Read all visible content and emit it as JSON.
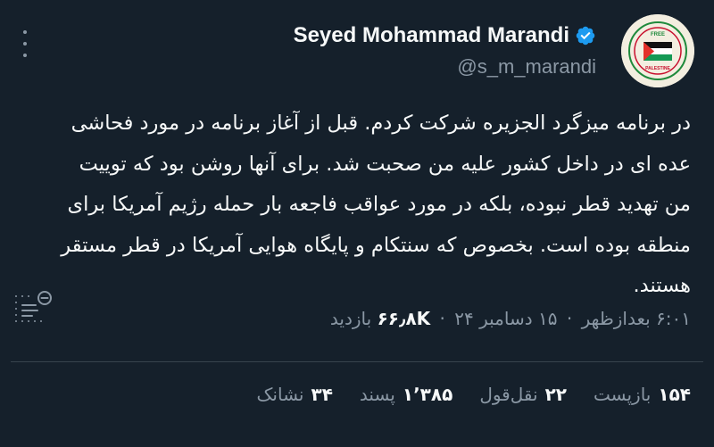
{
  "author": {
    "display_name": "Seyed Mohammad Marandi",
    "handle": "@s_m_marandi",
    "avatar_caption": "FREE PALESTINE"
  },
  "tweet": {
    "text": "در برنامه میزگرد الجزیره شرکت کردم. قبل از آغاز برنامه در مورد فحاشی عده ای در داخل کشور علیه من صحبت شد. برای آنها روشن بود که توییت من تهدید قطر نبوده، بلکه در مورد عواقب فاجعه بار حمله رژیم آمریکا برای منطقه بوده است. بخصوص که سنتکام و پایگاه هوایی آمریکا در قطر مستقر هستند."
  },
  "meta": {
    "time": "۶:۰۱ بعدازظهر",
    "date": "۱۵ دسامبر ۲۴",
    "separator": "·",
    "views_count": "۶۶٫۸K",
    "views_label": "بازدید"
  },
  "stats": {
    "retweets_count": "۱۵۴",
    "retweets_label": "بازپست",
    "quotes_count": "۲۲",
    "quotes_label": "نقل‌قول",
    "likes_count": "۱٬۳۸۵",
    "likes_label": "پسند",
    "bookmarks_count": "۳۴",
    "bookmarks_label": "نشانک"
  },
  "colors": {
    "background": "#15202b",
    "text_primary": "#f7f9f9",
    "text_secondary": "#8b98a5",
    "verified": "#1d9bf0",
    "divider": "#38444d"
  },
  "icons": {
    "more": "more-vertical-icon",
    "verified": "verified-badge-icon",
    "translate": "translate-icon"
  }
}
